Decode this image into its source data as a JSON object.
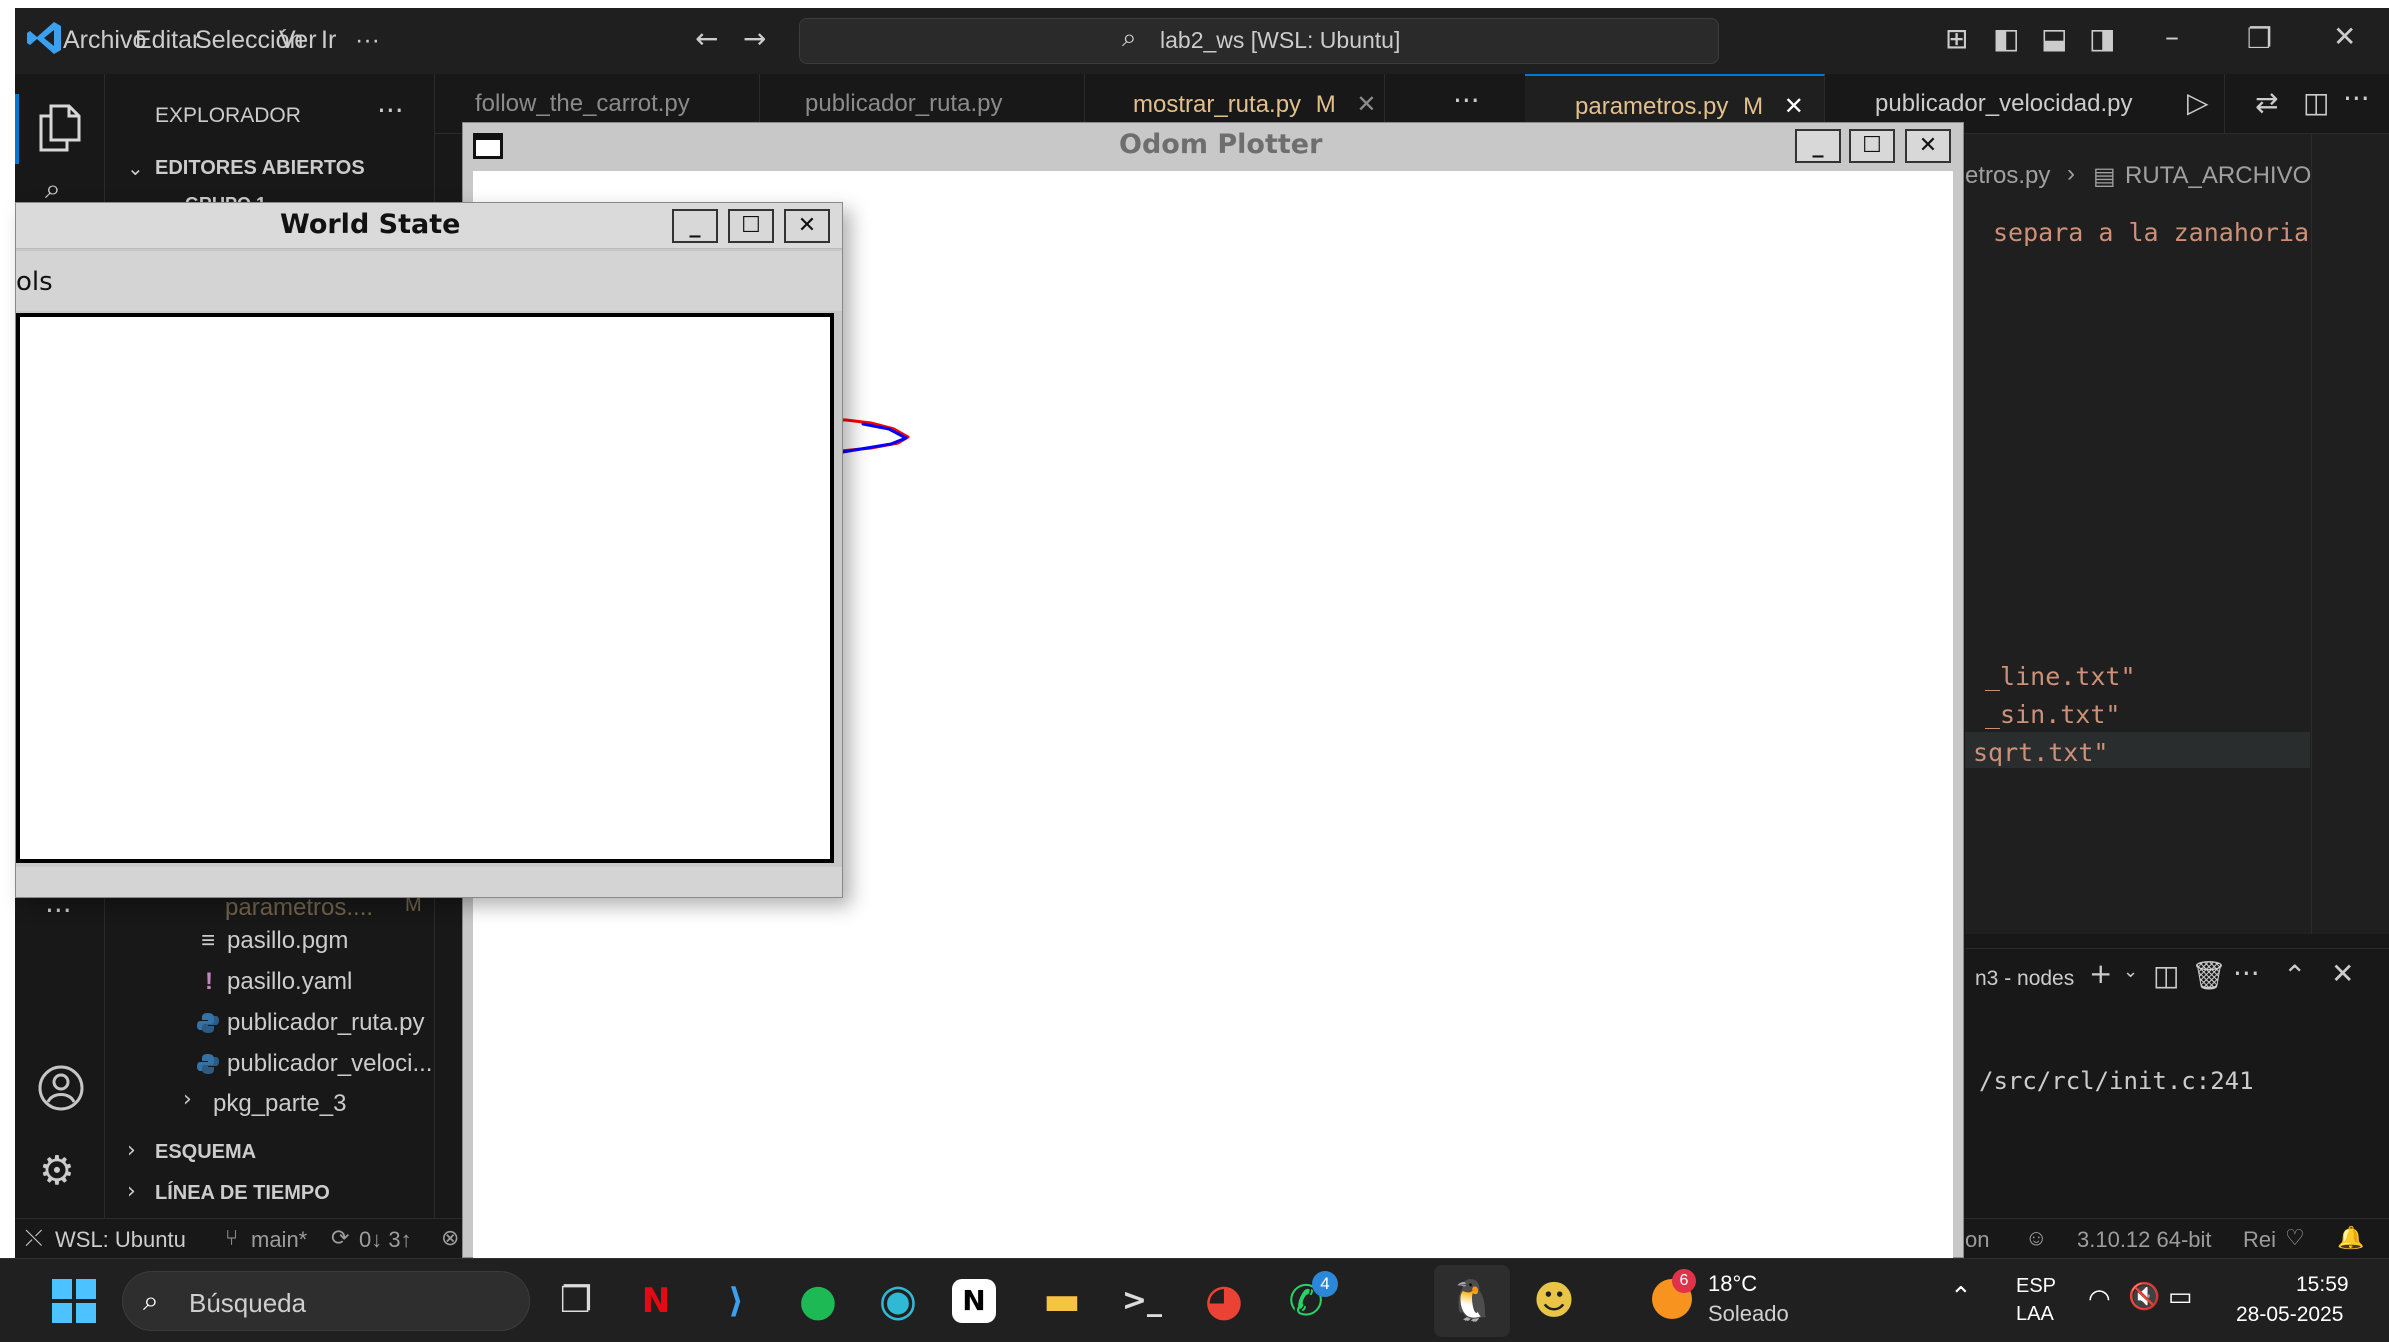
{
  "vscode": {
    "menu": [
      "Archivo",
      "Editar",
      "Selección",
      "Ver",
      "Ir",
      "···"
    ],
    "command_center": "lab2_ws [WSL: Ubuntu]",
    "sidebar": {
      "title": "EXPLORADOR",
      "open_editors": "EDITORES ABIERTOS",
      "group": "GRUPO 1",
      "files_partial": "parametros....",
      "files_partial_badge": "M",
      "files": [
        {
          "icon": "≡",
          "name": "pasillo.pgm"
        },
        {
          "icon": "!",
          "name": "pasillo.yaml"
        },
        {
          "icon": "py",
          "name": "publicador_ruta.py"
        },
        {
          "icon": "py",
          "name": "publicador_veloci..."
        }
      ],
      "folder": "pkg_parte_3",
      "outline": "ESQUEMA",
      "timeline": "LÍNEA DE TIEMPO"
    },
    "tabs": [
      {
        "label": "follow_the_carrot.py",
        "badge": ""
      },
      {
        "label": "publicador_ruta.py",
        "badge": ""
      },
      {
        "label": "mostrar_ruta.py",
        "badge": "M"
      },
      {
        "label": "parametros.py",
        "badge": "M"
      },
      {
        "label": "publicador_velocidad.py",
        "badge": ""
      }
    ],
    "breadcrumb_file": "etros.py",
    "breadcrumb_symbol": "RUTA_ARCHIVO",
    "editor_lines": {
      "comment": "separa a la zanahoria",
      "line1": "_line.txt\"",
      "line2": "_sin.txt\"",
      "line3": "sqrt.txt\""
    },
    "panel": {
      "title": "n3 - nodes",
      "output": "/src/rcl/init.c:241"
    },
    "statusbar": {
      "remote": "WSL: Ubuntu",
      "branch": "main*",
      "sync": "0↓ 3↑",
      "right_partial": "on",
      "python": "3.10.12 64-bit",
      "right2": "Rei"
    }
  },
  "world_state": {
    "title": "World State",
    "menu_partial": "ols"
  },
  "odom_plotter": {
    "title": "Odom Plotter",
    "chart_data": {
      "type": "line",
      "series": [
        {
          "color": "#ff0000",
          "points": [
            [
              820,
              418
            ],
            [
              845,
              419
            ],
            [
              870,
              422
            ],
            [
              893,
              428
            ],
            [
              907,
              436
            ],
            [
              897,
              442
            ],
            [
              870,
              447
            ],
            [
              840,
              450
            ],
            [
              822,
              455
            ]
          ]
        },
        {
          "color": "#0000ff",
          "points": [
            [
              804,
              474
            ],
            [
              815,
              462
            ],
            [
              830,
              453
            ],
            [
              860,
              448
            ],
            [
              890,
              443
            ],
            [
              905,
              437
            ],
            [
              888,
              428
            ],
            [
              862,
              423
            ]
          ]
        }
      ]
    }
  },
  "taskbar": {
    "search_placeholder": "Búsqueda",
    "weather_temp": "18°C",
    "weather_desc": "Soleado",
    "weather_badge": "6",
    "whatsapp_badge": "4",
    "lang1": "ESP",
    "lang2": "LAA",
    "time": "15:59",
    "date": "28-05-2025"
  },
  "colors": {
    "accent": "#0078d4",
    "modified": "#e2c08d"
  }
}
